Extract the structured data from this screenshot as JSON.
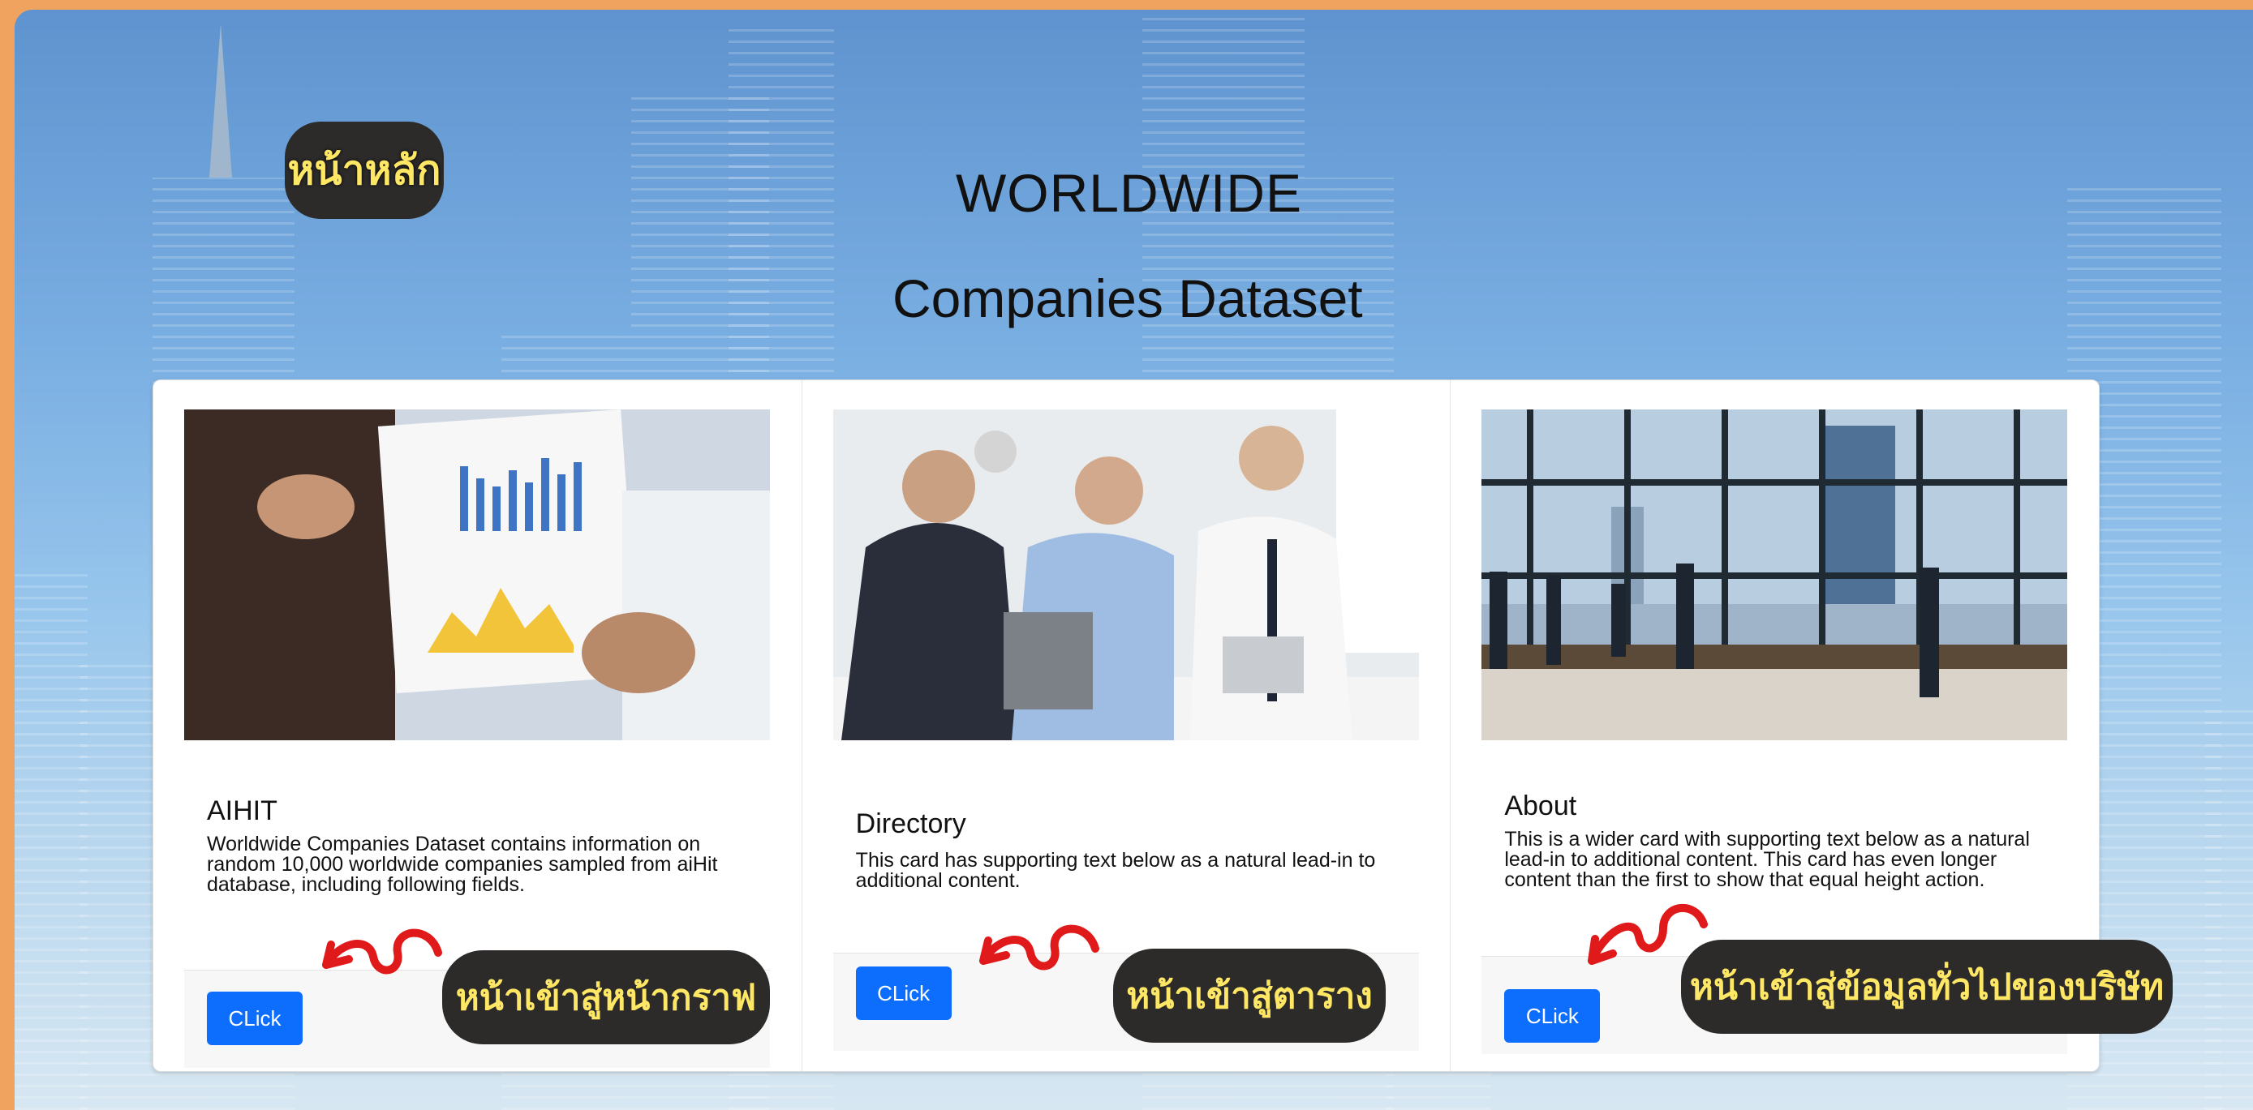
{
  "header": {
    "home_tag": "หน้าหลัก",
    "title_line1": "WORLDWIDE",
    "title_line2": "Companies Dataset"
  },
  "cards": [
    {
      "title": "AIHIT",
      "text": "Worldwide Companies Dataset contains information on random 10,000 worldwide companies sampled from aiHit database, including following fields.",
      "button_label": "CLick",
      "note_tag": "หน้าเข้าสู่หน้ากราฟ"
    },
    {
      "title": "Directory",
      "text": "This card has supporting text below as a natural lead-in to additional content.",
      "button_label": "CLick",
      "note_tag": "หน้าเข้าสู่ตาราง"
    },
    {
      "title": "About",
      "text": "This is a wider card with supporting text below as a natural lead-in to additional content. This card has even longer content than the first to show that equal height action.",
      "button_label": "CLick",
      "note_tag": "หน้าเข้าสู่ข้อมูลทั่วไปของบริษัท"
    }
  ],
  "colors": {
    "button": "#0d6efd",
    "note_bg": "#2c2b2a",
    "note_text": "#ffe766",
    "arrow": "#e01a1a",
    "frame": "#f0a25f"
  }
}
